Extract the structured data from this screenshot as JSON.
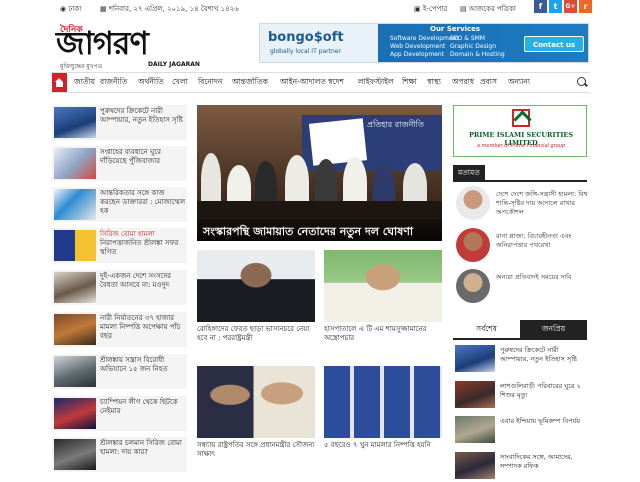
{
  "topbar": {
    "location": "ঢাকা",
    "date": "শনিবার, ২৭ এপ্রিল, ২০১৯, ১৪ বৈশাখ ১৪২৬",
    "epaper": "ই-পেপার",
    "today": "আজকের পত্রিকা",
    "social": [
      {
        "icon": "facebook-icon",
        "glyph": "f",
        "color": "#3b5998"
      },
      {
        "icon": "twitter-icon",
        "glyph": "t",
        "color": "#1da1f2"
      },
      {
        "icon": "googleplus-icon",
        "glyph": "G+",
        "color": "#dd4b39"
      },
      {
        "icon": "rss-icon",
        "glyph": "r",
        "color": "#f26522"
      }
    ]
  },
  "logo": {
    "small": "দৈনিক",
    "main": "জাগরণ",
    "tagline": "মুক্তিযুদ্ধের মুখপত্র",
    "english": "DAILY JAGARAN"
  },
  "ad": {
    "brand": "bongo$oft",
    "tagline": "globally local IT partner",
    "services_title": "Our Services",
    "col1": [
      "Software Development",
      "Web Development",
      "App Development"
    ],
    "col2": [
      "SEO & SMM",
      "Graphic Design",
      "Domain & Hosting"
    ],
    "cta": "Contact us"
  },
  "nav": {
    "items": [
      "জাতীয়",
      "রাজনীতি",
      "অর্থনীতি",
      "খেলা",
      "বিনোদন",
      "আন্তর্জাতিক",
      "আইন-আদালত",
      "স্বদেশ",
      "লাইফস্টাইল",
      "শিক্ষা",
      "স্বাস্থ্য",
      "অপরাধ",
      "প্রবাস",
      "অন্যান্য"
    ]
  },
  "left_news": [
    {
      "title": "পুরুষদের ক্রিকেটে নারী আম্পায়ার, নতুন ইতিহাস সৃষ্টি"
    },
    {
      "title": "সপ্তাহের ব্যবধানে ঘুরে দাঁড়িয়েছে পুঁজিবাজার"
    },
    {
      "title": "আন্তরিকতার সঙ্গে কাজ করছেন ডাক্তাররা : মোজাম্মেল হক"
    },
    {
      "tag": "সিরিজ বোমা হামলা",
      "title": "নিরাপত্তাজনিত শ্রীলঙ্কা সফর স্থগিত"
    },
    {
      "title": "দুই-একজন দেশে সংসদের বৈধতা আসবে না: মওদুদ"
    },
    {
      "title": "নারী নির্যাতনের ৩৭ হাজার মামলা নিষ্পত্তি অপেক্ষায় পাঁচ বছর"
    },
    {
      "title": "শ্রীলঙ্কায় সন্ত্রাস বিরোধী অভিযানে ১৫ জন নিহত"
    },
    {
      "title": "চ্যাম্পিয়ন লীগ থেকে ছিটকে নেইমার"
    },
    {
      "title": "শ্রীলঙ্কার চলমান সিরিজ বোমা হামলা: দায় কার?"
    }
  ],
  "hero": {
    "caption": "সংস্কারপন্থি জামায়াত নেতাদের নতুন দল ঘোষণা",
    "banner_text": "প্রতিহার রাজনীতি"
  },
  "center_news": [
    {
      "title": "রোহিঙ্গাদের ফেরত ছাড়া ভাসানচরে নেয়া হবে না : পররাষ্ট্রমন্ত্রী"
    },
    {
      "title": "হাসপাতালে এ টি এম শামসুজ্জামানের অস্ত্রোপচার"
    },
    {
      "title": "সন্ধ্যায় রাষ্ট্রপতির সঙ্গে প্রধানমন্ত্রীর সৌজন্য সাক্ষাৎ"
    },
    {
      "title": "৫ বছরেও ৭ খুন মামলার নিষ্পত্তি হয়নি"
    }
  ],
  "right_ad": {
    "name": "PRIME ISLAMI SECURITIES LIMITED",
    "sub": "a member of Prime Financial group"
  },
  "opinion": {
    "title": "মতামত",
    "items": [
      {
        "title": "দেশে দেশে জঙ্গি-সন্ত্রাসী হামলা: বিশ্ব শান্তি-সৃষ্টির দায় আদালে রাখার অপকৌশল"
      },
      {
        "title": "রানা প্লাজা: বিচারহীনতা এবং অনিরাপত্তার পথরেখা"
      },
      {
        "title": "অন্যরা প্রতিবাদই সময়ের দাবি"
      }
    ]
  },
  "tabs": {
    "latest": "সর্বশেষ",
    "popular": "জনপ্রিয়"
  },
  "latest_news": [
    {
      "title": "পুরুষদের ক্রিকেটে নারী আম্পায়ার, নতুন ইতিহাস সৃষ্টি"
    },
    {
      "title": "লাশগুলিবাড়ী পরিবারের ঘুরে ২ শিশুর মৃত্যু"
    },
    {
      "title": "এবার ইন্দিয়ায় ভূমিকম্প বিপর্যয়"
    },
    {
      "title": "সাংবাদিকের সঙ্গে, আমাদের, সম্পাদক রফিক"
    }
  ]
}
